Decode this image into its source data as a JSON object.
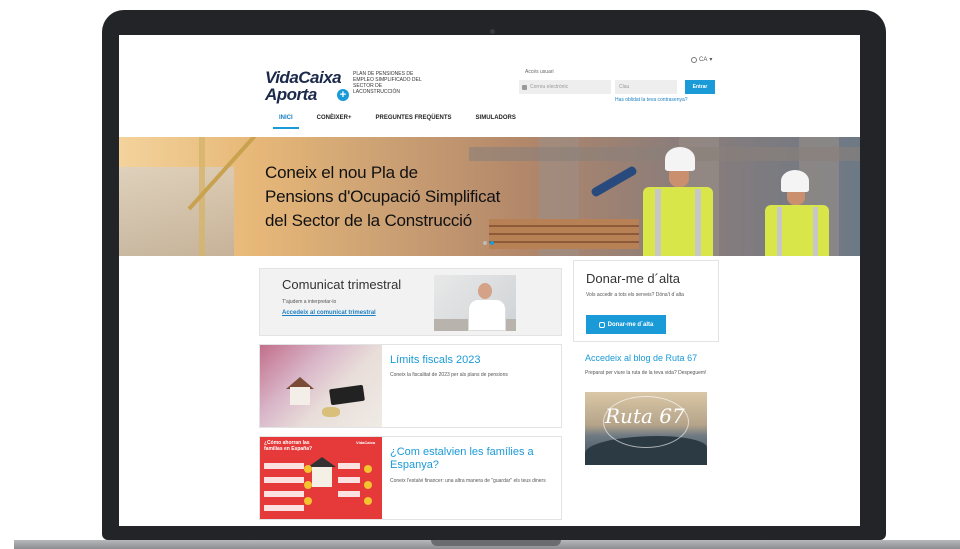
{
  "header": {
    "logo_line1": "VidaCaixa",
    "logo_line2": "Aporta",
    "plan_text": "PLAN DE PENSIONES DE EMPLEO SIMPLIFICADO DEL SECTOR DE LACONSTRUCCIÓN",
    "language": "CA",
    "access_label": "Accés usuari",
    "user_placeholder": "Correu electrònic",
    "password_placeholder": "Clau",
    "enter_label": "Entrar",
    "forgot_label": "Has oblidat la teva contrasenya?"
  },
  "nav": {
    "items": [
      "INICI",
      "CONÈIXER+",
      "PREGUNTES FREQÜENTS",
      "SIMULADORS"
    ],
    "active": "INICI"
  },
  "hero": {
    "line1": "Coneix el nou Pla de",
    "line2": "Pensions d'Ocupació Simplificat",
    "line3": "del Sector de la Construcció"
  },
  "comunicat": {
    "title": "Comunicat trimestral",
    "subtitle": "T'ajudem a interpretar-lo",
    "link": "Accedeix al comunicat trimestral"
  },
  "donar": {
    "title": "Donar-me d´alta",
    "subtitle": "Vols accedir a tots els serveis? Dóna't d´alta",
    "button": "Donar-me d´alta"
  },
  "limits": {
    "title": "Límits fiscals 2023",
    "subtitle": "Coneix la fiscalitat de 2023 per als plans de pensions"
  },
  "estalvien": {
    "title": "¿Com estalvien les famílies a Espanya?",
    "subtitle": "Coneix l'estalvi financer: una altra manera de \"guardar\" els teus diners",
    "infographic_title": "¿Cómo ahorran las familias en España?",
    "infographic_brand": "VidaCaixa"
  },
  "blog": {
    "title": "Accedeix al blog de Ruta 67",
    "subtitle": "Preparat per viure la ruta de la teva vida? Despeguem!",
    "logo_text": "Ruta 67"
  }
}
